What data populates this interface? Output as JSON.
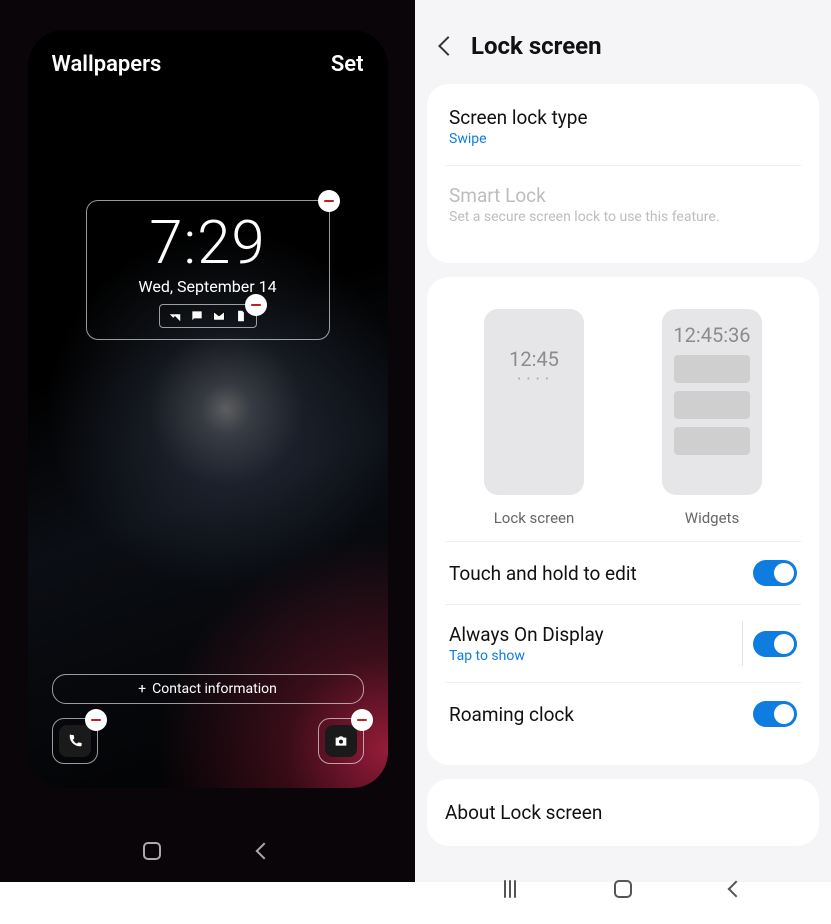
{
  "left": {
    "header": {
      "wallpapers": "Wallpapers",
      "set": "Set"
    },
    "clock": {
      "time": "7:29",
      "date": "Wed, September 14"
    },
    "contact": {
      "label": "Contact information"
    }
  },
  "right": {
    "title": "Lock screen",
    "block1": {
      "lock_type": {
        "title": "Screen lock type",
        "value": "Swipe"
      },
      "smart_lock": {
        "title": "Smart Lock",
        "sub": "Set a secure screen lock to use this feature."
      }
    },
    "previews": {
      "lock": {
        "label": "Lock screen",
        "time": "12:45",
        "dots": "• • • •"
      },
      "widgets": {
        "label": "Widgets",
        "time": "12:45:36"
      }
    },
    "toggles": {
      "touch_hold": {
        "title": "Touch and hold to edit"
      },
      "aod": {
        "title": "Always On Display",
        "sub": "Tap to show"
      },
      "roaming": {
        "title": "Roaming clock"
      }
    },
    "about": {
      "title": "About Lock screen"
    }
  }
}
